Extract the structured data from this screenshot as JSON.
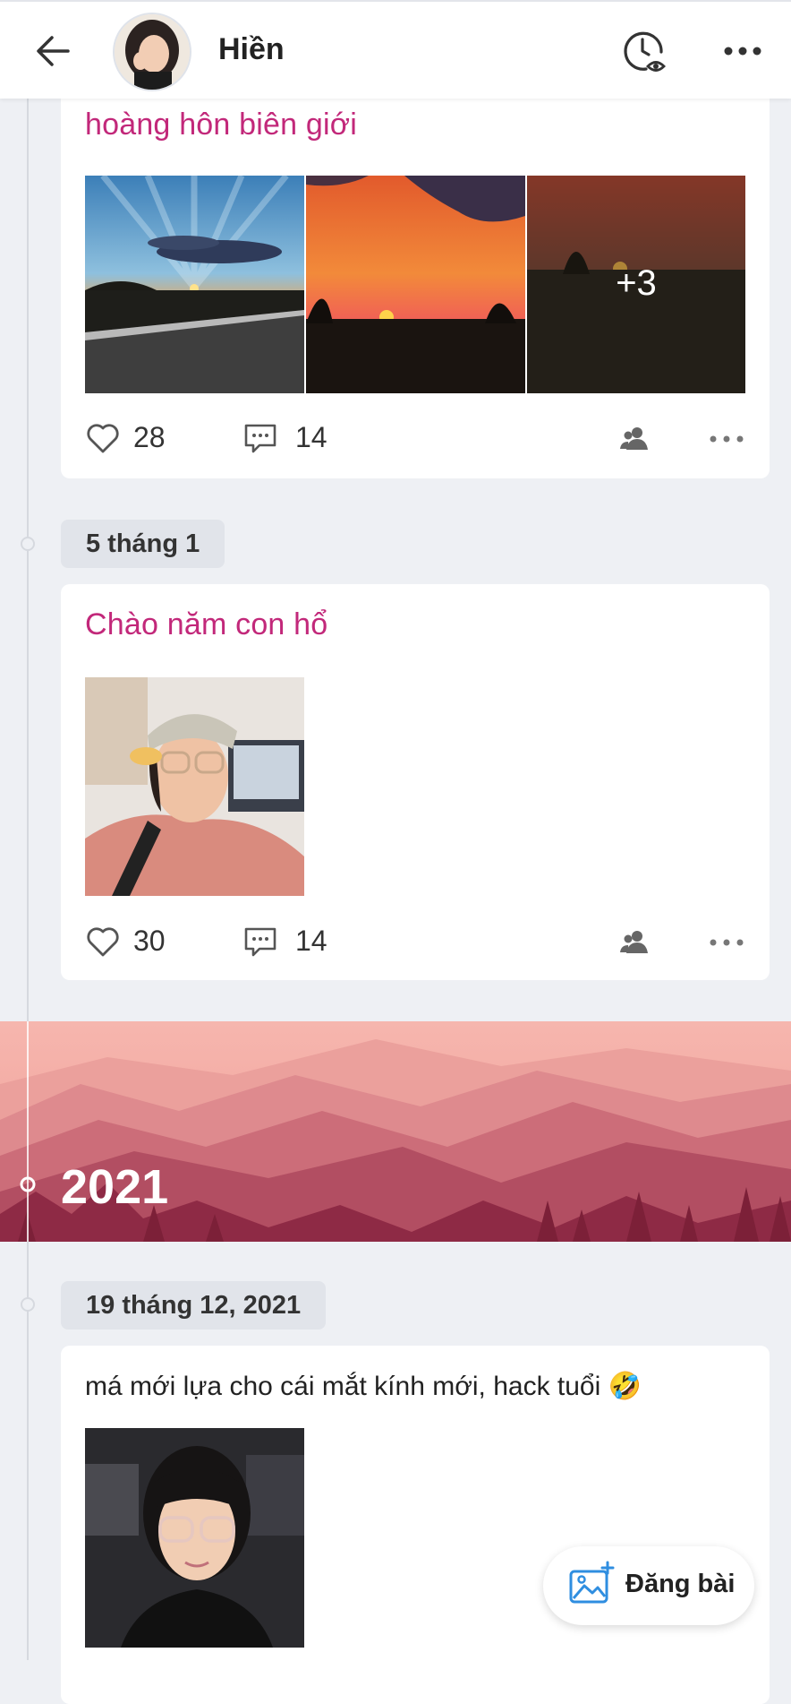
{
  "header": {
    "name": "Hiền",
    "back_icon": "arrow-left-icon",
    "history_icon": "clock-eye-icon",
    "more_icon": "more-horizontal-icon"
  },
  "posts": [
    {
      "title": "hoàng hôn biên giới",
      "extra_photos": "+3",
      "likes": "28",
      "comments": "14"
    },
    {
      "date": "5 tháng 1",
      "title": "Chào năm con hổ",
      "likes": "30",
      "comments": "14"
    },
    {
      "date": "19 tháng 12, 2021",
      "text": "má mới lựa cho cái mắt kính mới, hack tuổi 🤣"
    }
  ],
  "year_banner": {
    "year": "2021"
  },
  "fab": {
    "label": "Đăng bài",
    "icon": "add-photo-icon"
  },
  "colors": {
    "title_pink": "#c2287a",
    "accent_blue": "#2f8ee0",
    "banner_top": "#f4b0ac",
    "banner_bottom": "#8e2a45"
  }
}
